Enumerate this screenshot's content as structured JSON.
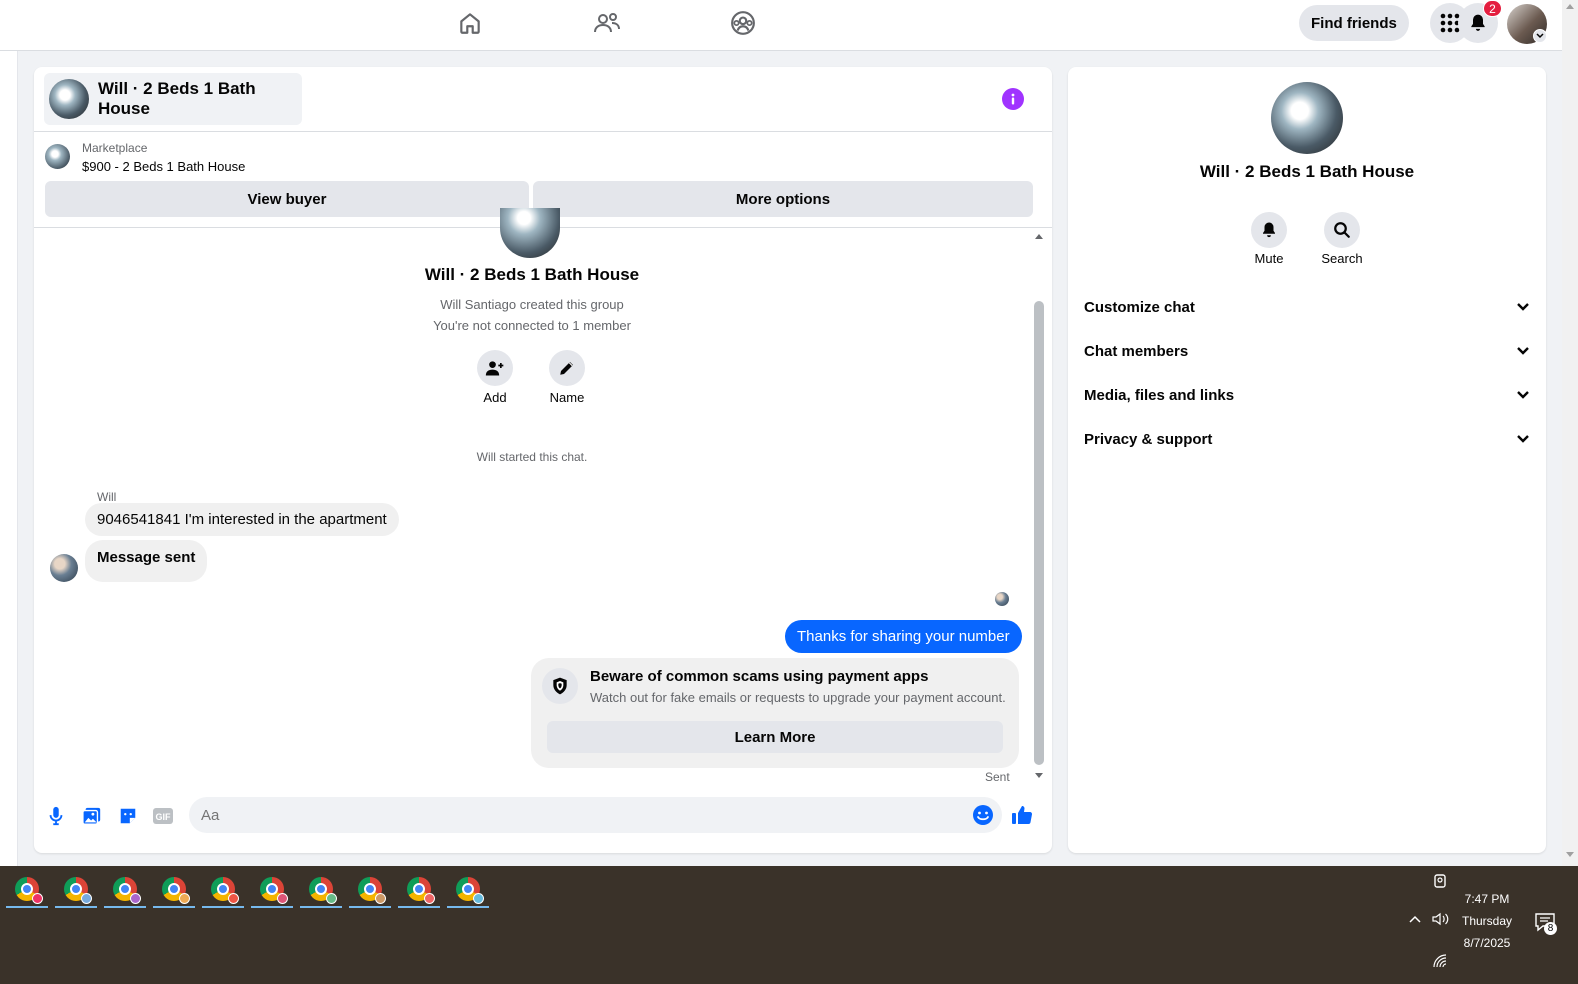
{
  "top_nav": {
    "find_friends_label": "Find friends",
    "notification_count": "2",
    "icons": [
      "home-icon",
      "friends-icon",
      "groups-icon",
      "menu-grid-icon",
      "bell-icon"
    ]
  },
  "conversation": {
    "title": "Will · 2 Beds 1 Bath House",
    "marketplace_label": "Marketplace",
    "listing": "$900 - 2 Beds 1 Bath House",
    "view_buyer_label": "View buyer",
    "more_options_label": "More options",
    "intro": {
      "title": "Will · 2 Beds 1 Bath House",
      "created_by": "Will Santiago created this group",
      "connection_note": "You're not connected to 1 member",
      "add_label": "Add",
      "name_label": "Name"
    },
    "system_note": "Will started this chat.",
    "messages": [
      {
        "sender": "Will",
        "text": "9046541841 I'm interested in the apartment",
        "direction": "incoming"
      },
      {
        "sender": "Will",
        "text": "Message sent",
        "direction": "incoming"
      },
      {
        "sender": "me",
        "text": "Thanks for sharing your number",
        "direction": "outgoing"
      }
    ],
    "scam_warning": {
      "title": "Beware of common scams using payment apps",
      "text": "Watch out for fake emails or requests to upgrade your payment account.",
      "button_label": "Learn More"
    },
    "sent_status": "Sent",
    "composer": {
      "placeholder": "Aa"
    }
  },
  "info_panel": {
    "title": "Will · 2 Beds 1 Bath House",
    "mute_label": "Mute",
    "search_label": "Search",
    "sections": [
      "Customize chat",
      "Chat members",
      "Media, files and links",
      "Privacy & support"
    ]
  },
  "taskbar": {
    "time": "7:47 PM",
    "day": "Thursday",
    "date": "8/7/2025",
    "notification_count": "8",
    "app_count": 10
  },
  "colors": {
    "accent_blue": "#0866ff",
    "info_purple": "#a033ff",
    "badge_red": "#e41e3f",
    "taskbar_bg": "#3a3229"
  }
}
